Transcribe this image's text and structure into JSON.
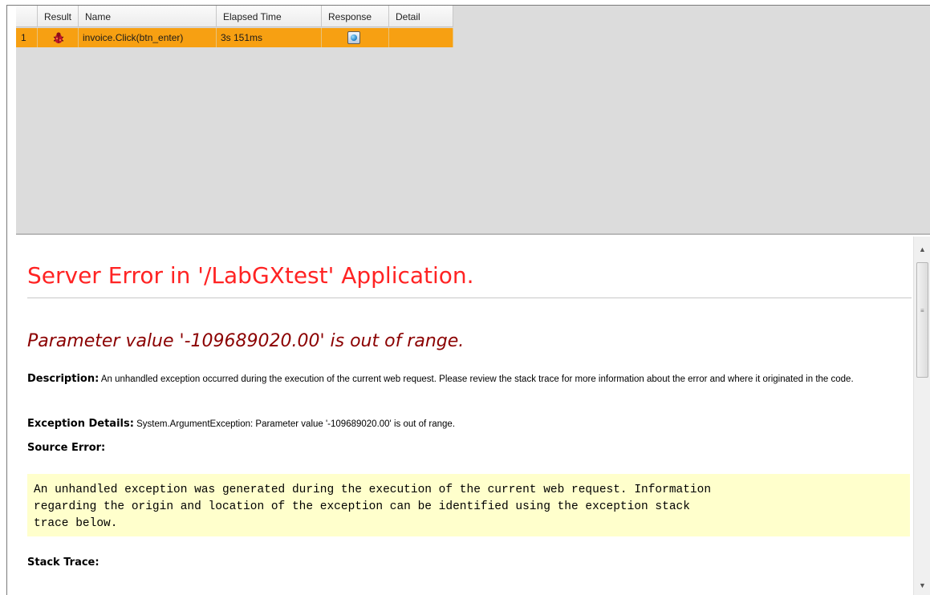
{
  "grid": {
    "columns": [
      "",
      "Result",
      "Name",
      "Elapsed Time",
      "Response",
      "Detail"
    ],
    "rows": [
      {
        "num": "1",
        "result_icon": "bug-icon",
        "name": "invoice.Click(btn_enter)",
        "elapsed": "3s 151ms",
        "response_icon": "web-response-icon",
        "detail": ""
      }
    ],
    "highlight_color": "#f7a012"
  },
  "page": {
    "title": "Server Error in '/LabGXtest' Application.",
    "subtitle": "Parameter value '-109689020.00' is out of range.",
    "description_label": "Description:",
    "description_text": "An unhandled exception occurred during the execution of the current web request. Please review the stack trace for more information about the error and where it originated in the code.",
    "exception_label": "Exception Details:",
    "exception_text": "System.ArgumentException: Parameter value '-109689020.00' is out of range.",
    "source_error_label": "Source Error:",
    "source_error_box": "An unhandled exception was generated during the execution of the current web request. Information\nregarding the origin and location of the exception can be identified using the exception stack\ntrace below.",
    "stack_trace_label": "Stack Trace:",
    "title_color": "#ff2323",
    "subtitle_color": "#8b0000",
    "code_bg": "#ffffcc"
  }
}
